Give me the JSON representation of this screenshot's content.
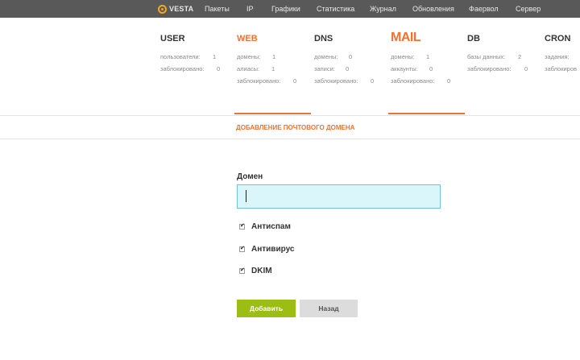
{
  "brand": {
    "logo_text": "VESTA",
    "accent_color": "#f5a623"
  },
  "nav": {
    "items": [
      "Пакеты",
      "IP",
      "Графики",
      "Статистика",
      "Журнал",
      "Обновления",
      "Фаервол",
      "Сервер"
    ]
  },
  "tabs": [
    {
      "title": "USER",
      "active": false,
      "stats": [
        [
          "пользователи:",
          "1"
        ],
        [
          "заблокировано:",
          "0"
        ]
      ]
    },
    {
      "title": "WEB",
      "active": false,
      "highlight": true,
      "stats": [
        [
          "домены:",
          "1"
        ],
        [
          "алиасы:",
          "1"
        ],
        [
          "заблокировано:",
          "0"
        ]
      ]
    },
    {
      "title": "DNS",
      "active": false,
      "stats": [
        [
          "домены:",
          "0"
        ],
        [
          "записи:",
          "0"
        ],
        [
          "заблокировано:",
          "0"
        ]
      ]
    },
    {
      "title": "MAIL",
      "active": true,
      "stats": [
        [
          "домены:",
          "1"
        ],
        [
          "аккаунты:",
          "0"
        ],
        [
          "заблокировано:",
          "0"
        ]
      ]
    },
    {
      "title": "DB",
      "active": false,
      "stats": [
        [
          "базы данных:",
          "2"
        ],
        [
          "заблокировано:",
          "0"
        ]
      ]
    },
    {
      "title": "CRON",
      "active": false,
      "stats": [
        [
          "задания:",
          ""
        ],
        [
          "заблокиров",
          ""
        ]
      ]
    }
  ],
  "section_title": "ДОБАВЛЕНИЕ ПОЧТОВОГО ДОМЕНА",
  "form": {
    "domain_label": "Домен",
    "domain_value": "",
    "checkboxes": [
      {
        "label": "Антиспам",
        "checked": true
      },
      {
        "label": "Антивирус",
        "checked": true
      },
      {
        "label": "DKIM",
        "checked": true
      }
    ],
    "add_label": "Добавить",
    "back_label": "Назад"
  },
  "colors": {
    "orange": "#f07230",
    "green": "#9bbd14",
    "input_bg": "#daf6fb",
    "topbar": "#595959"
  }
}
